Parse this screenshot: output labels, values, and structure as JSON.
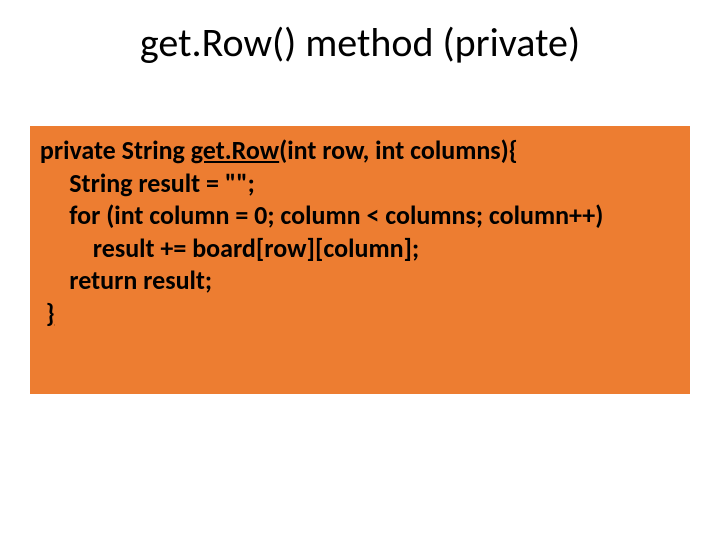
{
  "title": "get.Row() method (private)",
  "code": {
    "line1_prefix": " private String ",
    "line1_underlined": "get.Row",
    "line1_suffix": "(int row, int columns){",
    "line2": "      String result = \"\";",
    "line3": "      for (int column = 0; column < columns; column++)",
    "line4": "          result += board[row][column];",
    "line5": "      return result;",
    "line6_indent": "  ",
    "line6_brace": "}"
  }
}
